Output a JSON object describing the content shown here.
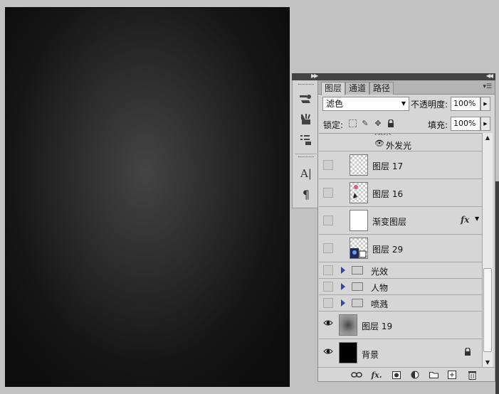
{
  "panel": {
    "tabs": [
      {
        "label": "图层"
      },
      {
        "label": "通道"
      },
      {
        "label": "路径"
      }
    ],
    "blend_mode": "滤色",
    "opacity_label": "不透明度:",
    "opacity_value": "100%",
    "lock_label": "锁定:",
    "fill_label": "填充:",
    "fill_value": "100%"
  },
  "layers": {
    "partial_label": "效果",
    "effect_outer_glow": "外发光",
    "items": [
      {
        "name": "图层 17"
      },
      {
        "name": "图层 16"
      },
      {
        "name": "渐变图层"
      },
      {
        "name": "图层 29"
      },
      {
        "name": "光效"
      },
      {
        "name": "人物"
      },
      {
        "name": "喷溅"
      },
      {
        "name": "图层 19"
      },
      {
        "name": "背景"
      }
    ]
  },
  "icons": {
    "collapse": "double-arrow-left-icon",
    "expand": "double-arrow-right-icon"
  }
}
